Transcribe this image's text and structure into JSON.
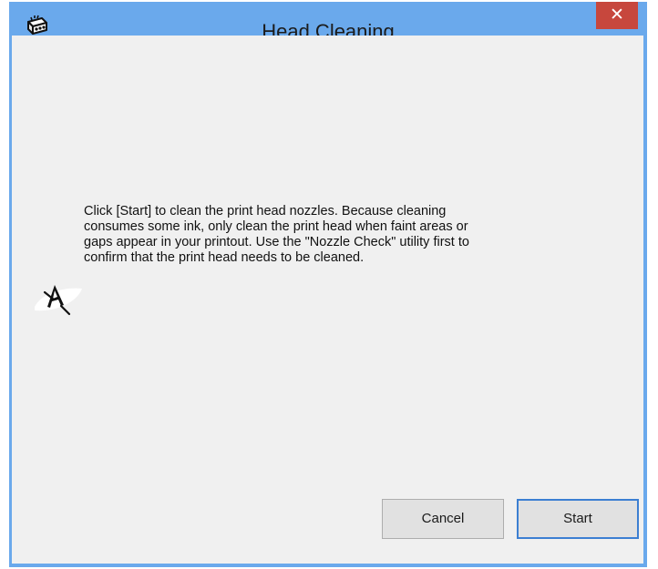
{
  "window": {
    "title": "Head Cleaning",
    "app_icon": "printer-icon",
    "close_glyph": "✕"
  },
  "content": {
    "message": "Click [Start] to clean the print head nozzles. Because cleaning\nconsumes some ink, only clean the print head when faint areas or\ngaps appear in your printout. Use the \"Nozzle Check\" utility first to\nconfirm that the print head needs to be cleaned.",
    "illustration_icon": "print-head-cleaning-icon"
  },
  "buttons": {
    "cancel_label": "Cancel",
    "start_label": "Start"
  },
  "colors": {
    "titlebar": "#6aa9ec",
    "close_button": "#c7473d",
    "client_background": "#f0f0f0",
    "default_button_border": "#3c7fd2"
  }
}
